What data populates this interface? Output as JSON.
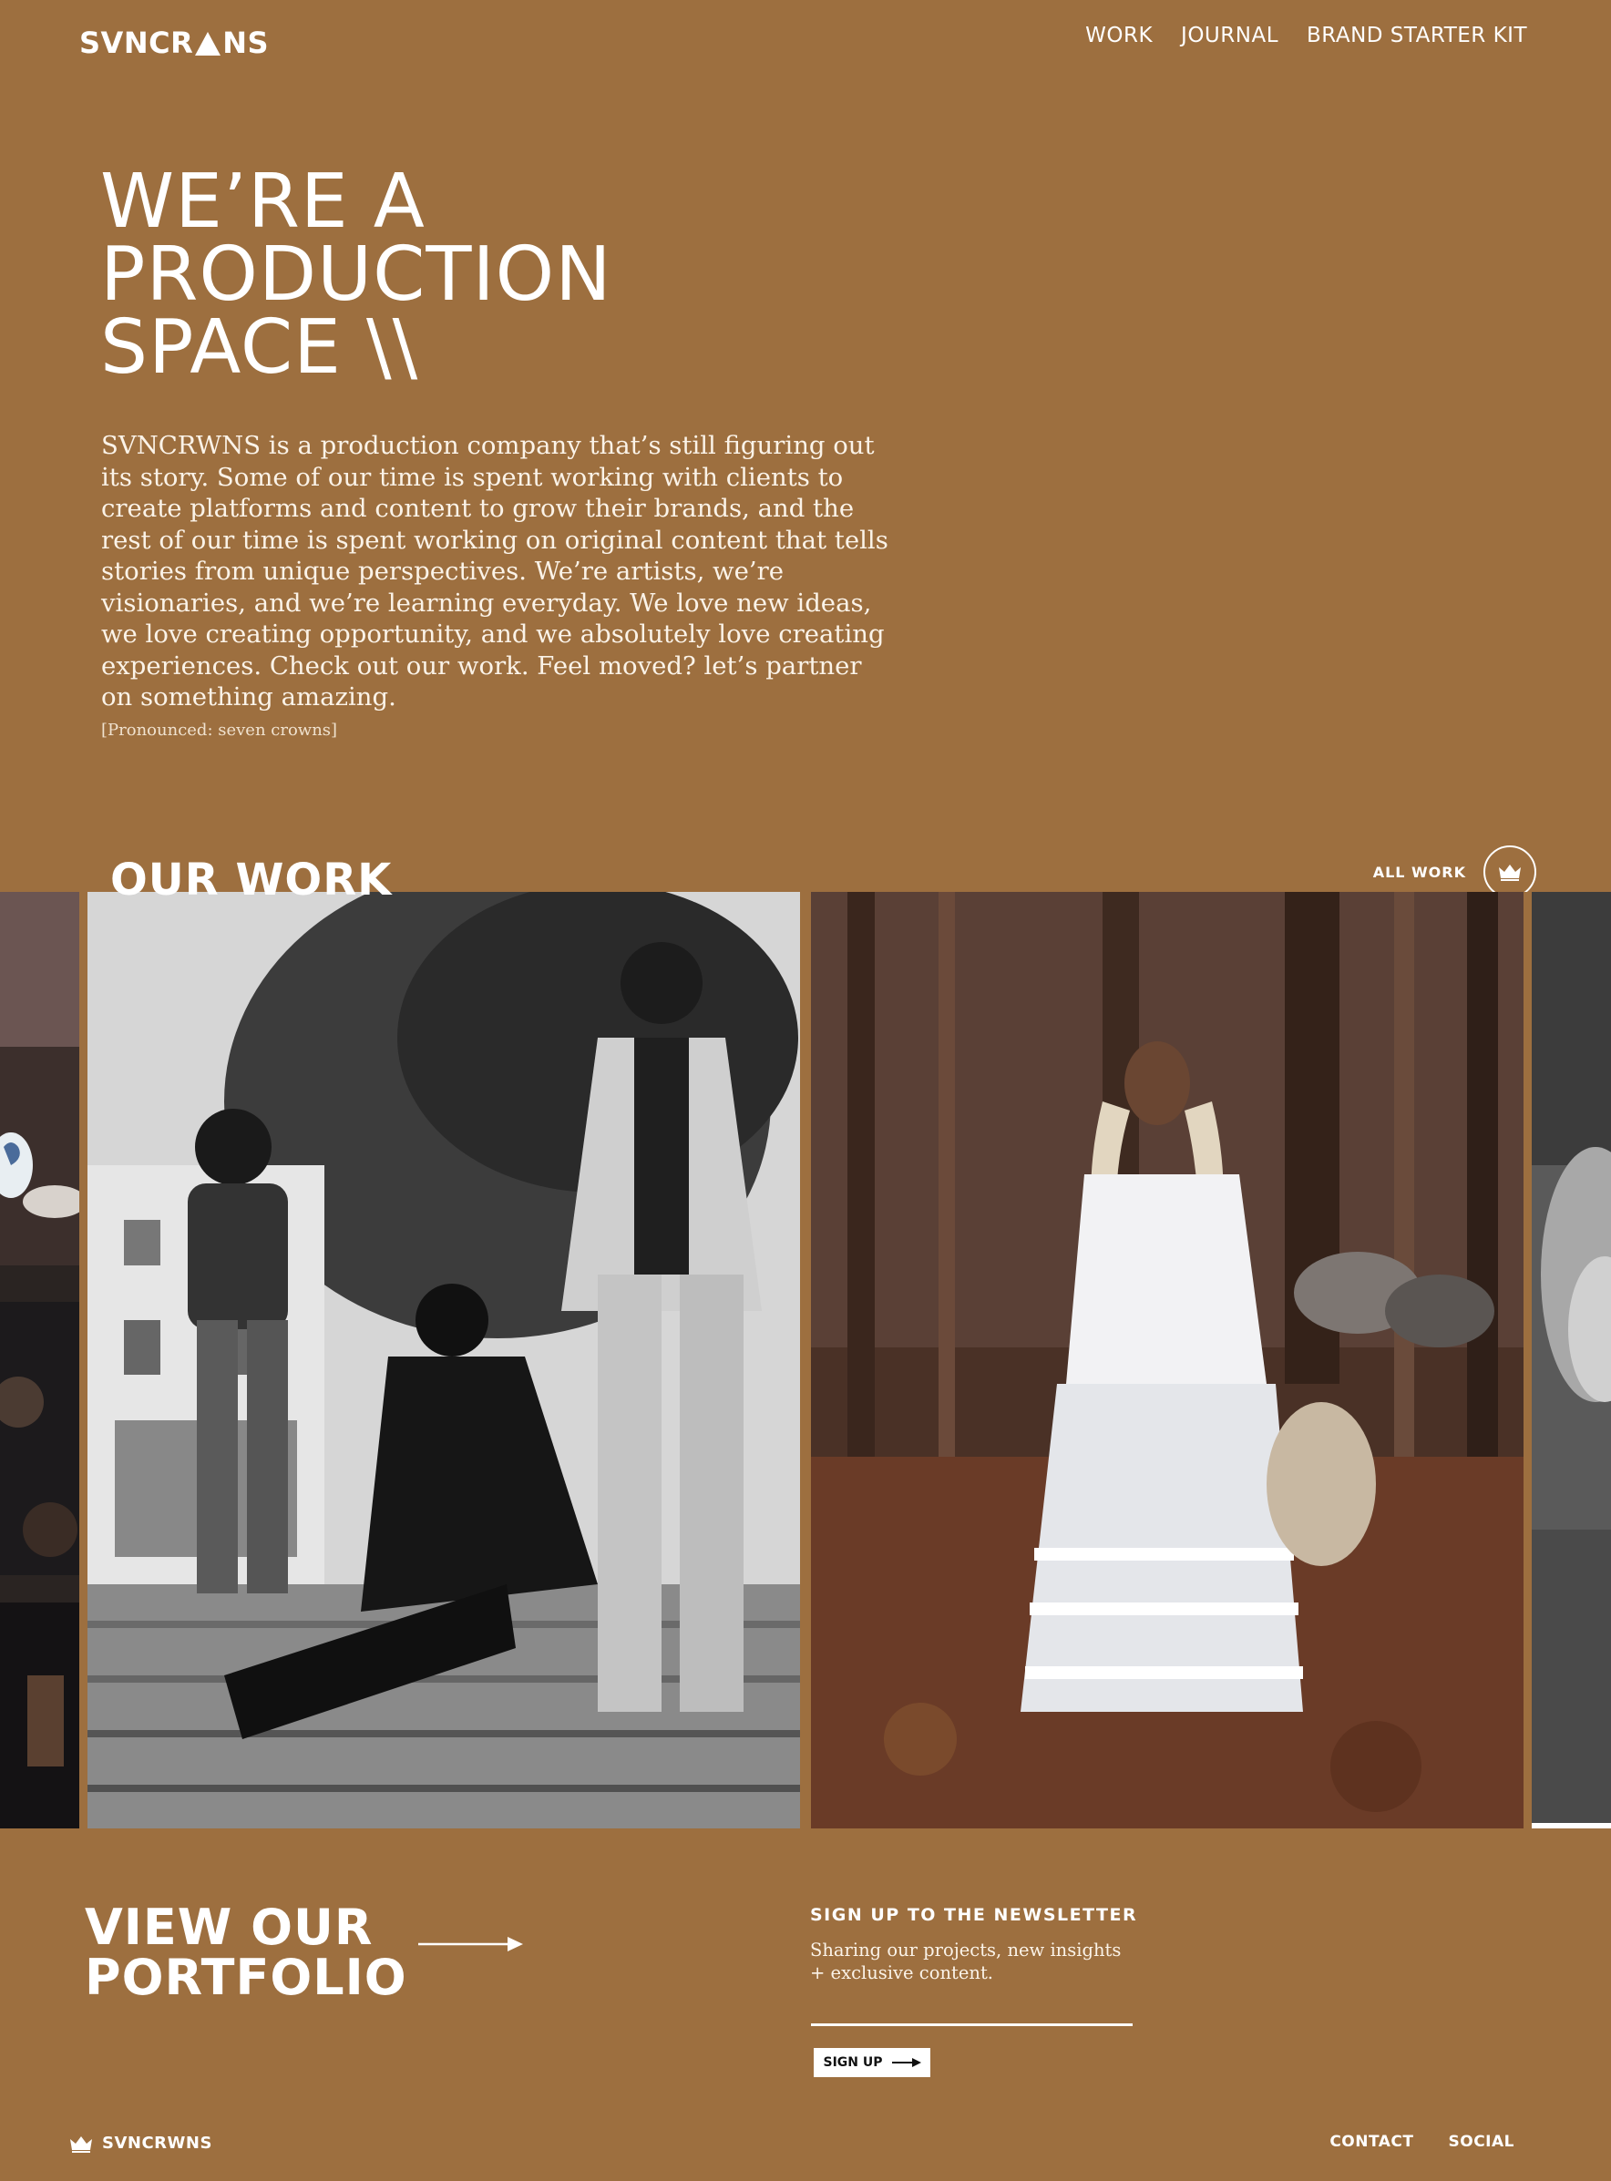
{
  "nav": {
    "logo_left": "SVNCR",
    "logo_right": "NS",
    "links": [
      "WORK",
      "JOURNAL",
      "BRAND STARTER KIT"
    ]
  },
  "hero": {
    "title_line1": "WE’RE A",
    "title_line2": "PRODUCTION",
    "title_line3": "SPACE \\\\",
    "body": "SVNCRWNS is a production company that’s still figuring out its story. Some of our time is spent working with clients to create platforms and content to grow their brands, and the rest of our time is spent working on original content that tells stories from unique perspectives. We’re artists, we’re visionaries, and we’re learning everyday. We love new ideas, we love creating opportunity, and we absolutely love creating experiences. Check out our work. Feel moved? let’s partner on something amazing.",
    "note": "[Pronounced: seven crowns]"
  },
  "work": {
    "title": "OUR WORK",
    "all_work_label": "ALL WORK",
    "all_work_icon": "crown-icon"
  },
  "portfolio": {
    "line1": "VIEW OUR",
    "line2": "PORTFOLIO",
    "arrow_icon": "arrow-right-icon"
  },
  "newsletter": {
    "title": "SIGN UP TO THE NEWSLETTER",
    "text": "Sharing our projects, new insights + exclusive content.",
    "input_value": "",
    "button_label": "SIGN UP"
  },
  "footer": {
    "brand": "SVNCRWNS",
    "links": [
      "CONTACT",
      "SOCIAL"
    ]
  },
  "colors": {
    "background": "#9d6f3f",
    "text": "#ffffff"
  }
}
